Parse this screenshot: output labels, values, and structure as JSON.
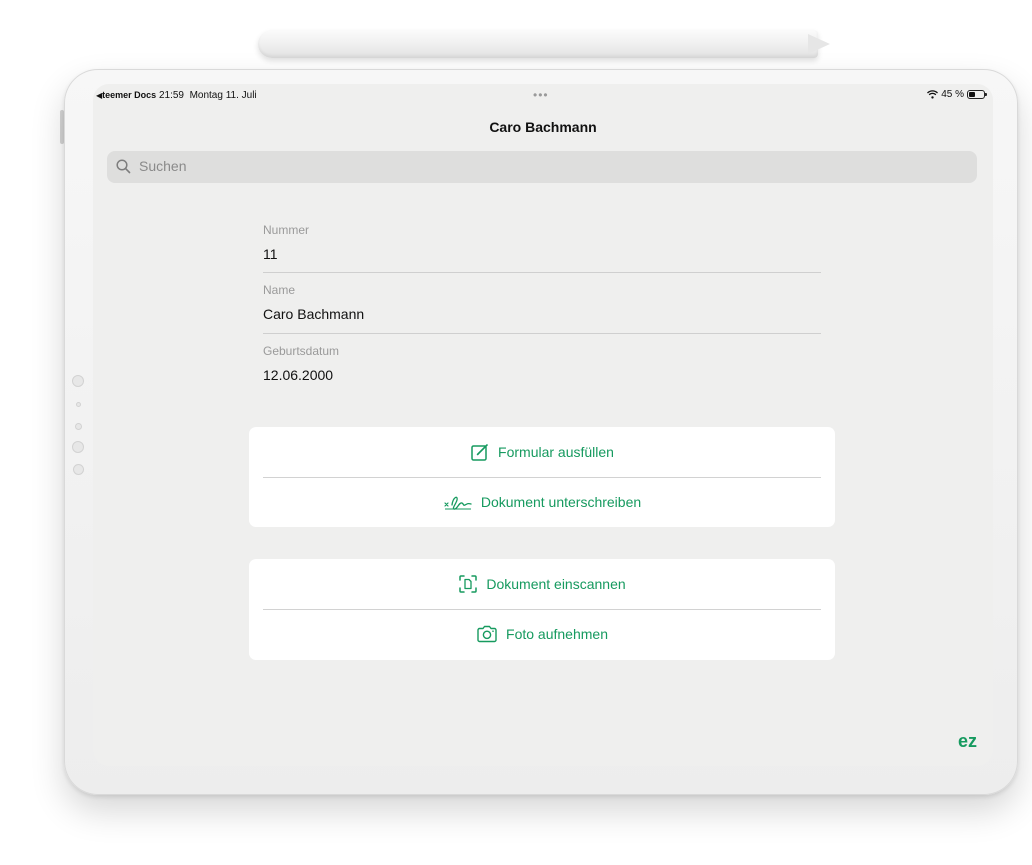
{
  "status_bar": {
    "back_arrow": "◀",
    "back_app": "teemer Docs",
    "time": "21:59",
    "date": "Montag 11. Juli",
    "multitask_dots": "•••",
    "battery_level": "45 %",
    "battery_fraction": 0.45,
    "wifi_icon": "wifi-icon"
  },
  "nav": {
    "title": "Caro Bachmann"
  },
  "search": {
    "placeholder": "Suchen",
    "value": ""
  },
  "fields": [
    {
      "label": "Nummer",
      "value": "11"
    },
    {
      "label": "Name",
      "value": "Caro Bachmann"
    },
    {
      "label": "Geburtsdatum",
      "value": "12.06.2000"
    }
  ],
  "actions_group_1": [
    {
      "label": "Formular ausfüllen",
      "icon": "edit-form-icon"
    },
    {
      "label": "Dokument unterschreiben",
      "icon": "signature-icon"
    }
  ],
  "actions_group_2": [
    {
      "label": "Dokument einscannen",
      "icon": "scan-document-icon"
    },
    {
      "label": "Foto aufnehmen",
      "icon": "camera-icon"
    }
  ],
  "brand": {
    "logo_icon": "brand-logo-icon",
    "logo_text": "ez"
  },
  "colors": {
    "accent": "#169a5f",
    "screen_background": "#efefee",
    "card_background": "#ffffff"
  }
}
